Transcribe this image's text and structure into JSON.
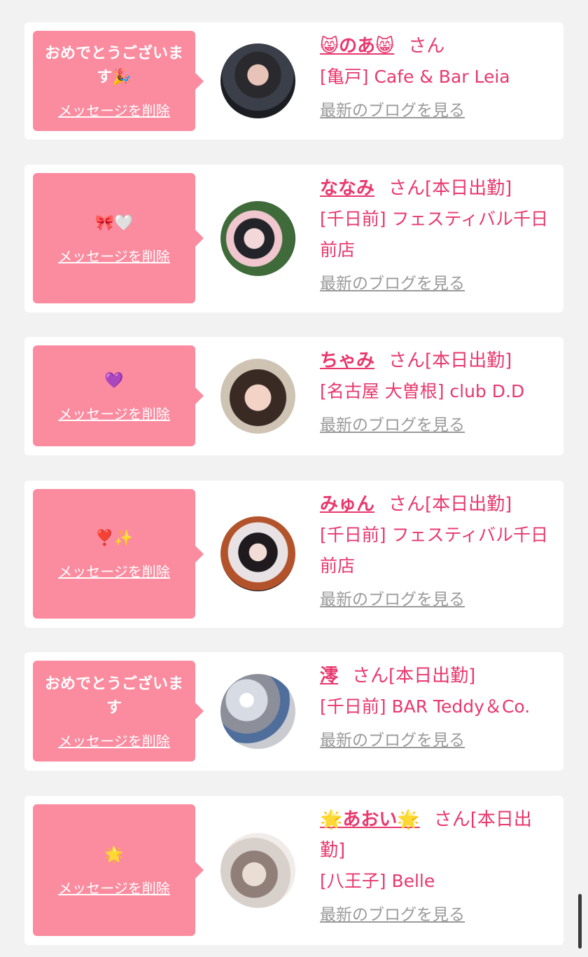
{
  "items": [
    {
      "message": "おめでとうございます🎉",
      "delete_label": "メッセージを削除",
      "name": "😸のあ😸",
      "san": "さん",
      "status": "",
      "shop": "[亀戸] Cafe & Bar Leia",
      "blog_label": "最新のブログを見る"
    },
    {
      "message": "🎀🤍",
      "delete_label": "メッセージを削除",
      "name": "ななみ",
      "san": "さん",
      "status": "[本日出勤]",
      "shop": "[千日前] フェスティバル千日前店",
      "blog_label": "最新のブログを見る"
    },
    {
      "message": "💜",
      "delete_label": "メッセージを削除",
      "name": "ちゃみ",
      "san": "さん",
      "status": "[本日出勤]",
      "shop": "[名古屋 大曽根] club D.D",
      "blog_label": "最新のブログを見る"
    },
    {
      "message": "❣️✨",
      "delete_label": "メッセージを削除",
      "name": "みゅん",
      "san": "さん",
      "status": "[本日出勤]",
      "shop": "[千日前] フェスティバル千日前店",
      "blog_label": "最新のブログを見る"
    },
    {
      "message": "おめでとうございます",
      "delete_label": "メッセージを削除",
      "name": "澪",
      "san": "さん",
      "status": "[本日出勤]",
      "shop": "[千日前] BAR Teddy＆Co.",
      "blog_label": "最新のブログを見る"
    },
    {
      "message": "🌟",
      "delete_label": "メッセージを削除",
      "name": "🌟あおい🌟",
      "san": "さん",
      "status": "[本日出勤]",
      "shop": "[八王子] Belle",
      "blog_label": "最新のブログを見る"
    }
  ],
  "colors": {
    "accent": "#e8386e",
    "bubble": "#fb8b9f",
    "link_gray": "#9a9a9a",
    "background": "#f2f2f2"
  }
}
